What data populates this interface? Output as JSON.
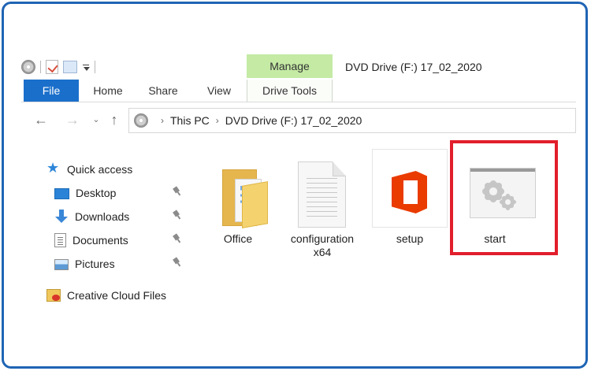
{
  "window": {
    "title": "DVD Drive (F:) 17_02_2020",
    "context_tab": "Manage",
    "highlight_color": "#e21e2c",
    "frame_color": "#1f64b4"
  },
  "quick_access_toolbar": {
    "icons": [
      "drive-disc-icon",
      "properties-icon",
      "new-folder-icon",
      "customize-toolbar-icon"
    ]
  },
  "ribbon": {
    "tabs": [
      {
        "label": "File"
      },
      {
        "label": "Home"
      },
      {
        "label": "Share"
      },
      {
        "label": "View"
      },
      {
        "label": "Drive Tools"
      }
    ]
  },
  "navigation": {
    "back_icon": "back-arrow-icon",
    "forward_icon": "forward-arrow-icon",
    "recent_icon": "recent-locations-icon",
    "up_icon": "up-arrow-icon",
    "breadcrumb": {
      "root_label": "This PC",
      "current_label": "DVD Drive (F:) 17_02_2020"
    }
  },
  "sidebar": {
    "items": [
      {
        "label": "Quick access",
        "icon": "star-icon"
      },
      {
        "label": "Desktop",
        "icon": "desktop-icon"
      },
      {
        "label": "Downloads",
        "icon": "download-icon"
      },
      {
        "label": "Documents",
        "icon": "documents-icon"
      },
      {
        "label": "Pictures",
        "icon": "pictures-icon"
      },
      {
        "label": "Creative Cloud Files",
        "icon": "creative-cloud-icon"
      }
    ]
  },
  "files": [
    {
      "label": "Office",
      "type": "folder"
    },
    {
      "label": "configuration\nx64",
      "type": "document"
    },
    {
      "label": "setup",
      "type": "office-app"
    },
    {
      "label": "start",
      "type": "application"
    }
  ]
}
